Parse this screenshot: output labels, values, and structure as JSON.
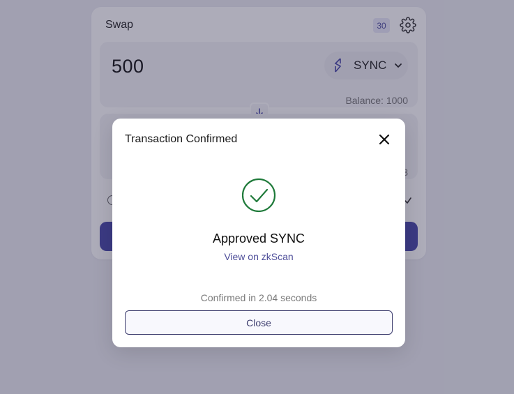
{
  "swap": {
    "title": "Swap",
    "slippage_badge": "30",
    "from": {
      "amount": "500",
      "token_symbol": "SYNC",
      "balance": "Balance: 1000"
    },
    "to": {
      "partial_value": "3"
    }
  },
  "modal": {
    "title": "Transaction Confirmed",
    "status_text": "Approved SYNC",
    "explorer_link": "View on zkScan",
    "confirmation_text": "Confirmed in 2.04 seconds",
    "close_label": "Close"
  },
  "colors": {
    "success": "#1f7a3a",
    "accent": "#4848a8",
    "link": "#4f4f9a"
  },
  "icons": {
    "settings": "gear-icon",
    "token": "sync-token-icon",
    "dropdown": "chevron-down-icon",
    "flip": "arrow-down-icon",
    "close": "close-icon",
    "success": "check-circle-icon"
  }
}
